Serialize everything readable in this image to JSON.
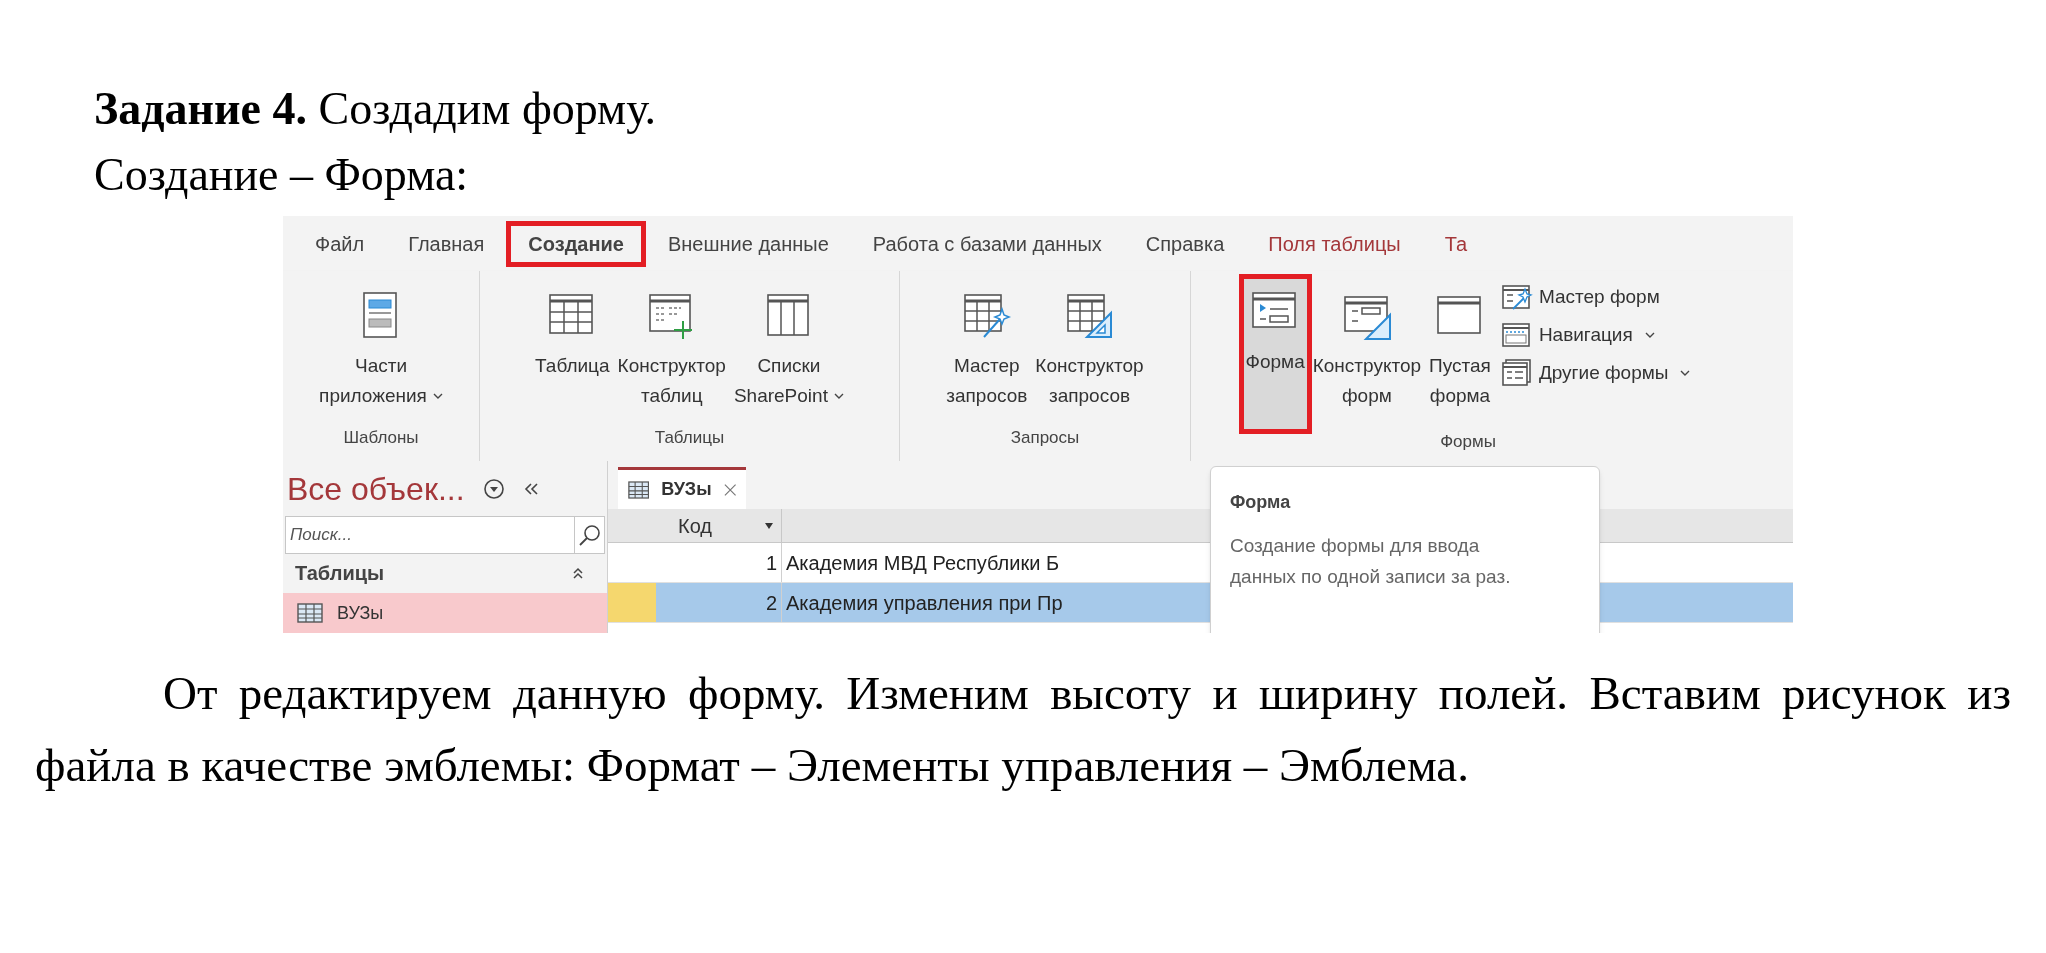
{
  "heading": "**Задание 4.** Создадим форму.",
  "path": "Создание – Форма:",
  "screenshot": {
    "ribbon_tabs": [
      {
        "label": "Файл",
        "selected": false,
        "kind": "normal",
        "highlighted": false
      },
      {
        "label": "Главная",
        "selected": false,
        "kind": "normal",
        "highlighted": false
      },
      {
        "label": "Создание",
        "selected": true,
        "kind": "normal",
        "highlighted": true
      },
      {
        "label": "Внешние данные",
        "selected": false,
        "kind": "normal",
        "highlighted": false
      },
      {
        "label": "Работа с базами данных",
        "selected": false,
        "kind": "normal",
        "highlighted": false
      },
      {
        "label": "Справка",
        "selected": false,
        "kind": "normal",
        "highlighted": false
      },
      {
        "label": "Поля таблицы",
        "selected": false,
        "kind": "contextual",
        "highlighted": false
      },
      {
        "label": "Та",
        "selected": false,
        "kind": "contextual",
        "highlighted": false
      }
    ],
    "groups": [
      {
        "label": "Шаблоны",
        "buttons": [
          {
            "kind": "large",
            "lines": [
              "Части",
              "приложения"
            ],
            "dropdown": true,
            "highlighted": false
          }
        ]
      },
      {
        "label": "Таблицы",
        "buttons": [
          {
            "kind": "large",
            "lines": [
              "Таблица"
            ],
            "dropdown": false,
            "highlighted": false
          },
          {
            "kind": "large",
            "lines": [
              "Конструктор",
              "таблиц"
            ],
            "dropdown": false,
            "highlighted": false
          },
          {
            "kind": "large",
            "lines": [
              "Списки",
              "SharePoint"
            ],
            "dropdown": true,
            "highlighted": false
          }
        ]
      },
      {
        "label": "Запросы",
        "buttons": [
          {
            "kind": "large",
            "lines": [
              "Мастер",
              "запросов"
            ],
            "dropdown": false,
            "highlighted": false
          },
          {
            "kind": "large",
            "lines": [
              "Конструктор",
              "запросов"
            ],
            "dropdown": false,
            "highlighted": false
          }
        ]
      },
      {
        "label": "Формы",
        "buttons": [
          {
            "kind": "large",
            "lines": [
              "Форма"
            ],
            "dropdown": false,
            "highlighted": true
          },
          {
            "kind": "large",
            "lines": [
              "Конструктор",
              "форм"
            ],
            "dropdown": false,
            "highlighted": false
          },
          {
            "kind": "large",
            "lines": [
              "Пустая",
              "форма"
            ],
            "dropdown": false,
            "highlighted": false
          },
          {
            "kind": "small",
            "lines": [
              "Мастер форм"
            ],
            "dropdown": false,
            "highlighted": false
          },
          {
            "kind": "small",
            "lines": [
              "Навигация"
            ],
            "dropdown": true,
            "highlighted": false
          },
          {
            "kind": "small",
            "lines": [
              "Другие формы"
            ],
            "dropdown": true,
            "highlighted": false
          }
        ]
      }
    ],
    "nav_pane": {
      "title": "Все объек...",
      "search_placeholder": "Поиск...",
      "section": "Таблицы",
      "items": [
        {
          "label": "ВУЗы",
          "selected": true
        }
      ]
    },
    "datasheet": {
      "tab": "ВУЗы",
      "columns": [
        "Код"
      ],
      "rows": [
        {
          "id": "1",
          "name": "Академия МВД Республики Б",
          "selected": false
        },
        {
          "id": "2",
          "name": "Академия управления при Пр",
          "selected": true
        }
      ]
    },
    "tooltip": {
      "title": "Форма",
      "text": "Создание формы для ввода данных по одной записи за раз."
    }
  },
  "paragraph": "От редактируем данную форму. Изменим высоту и ширину полей. Вставим рисунок из файла в качестве эмблемы: Формат – Элементы управления – Эмблема."
}
